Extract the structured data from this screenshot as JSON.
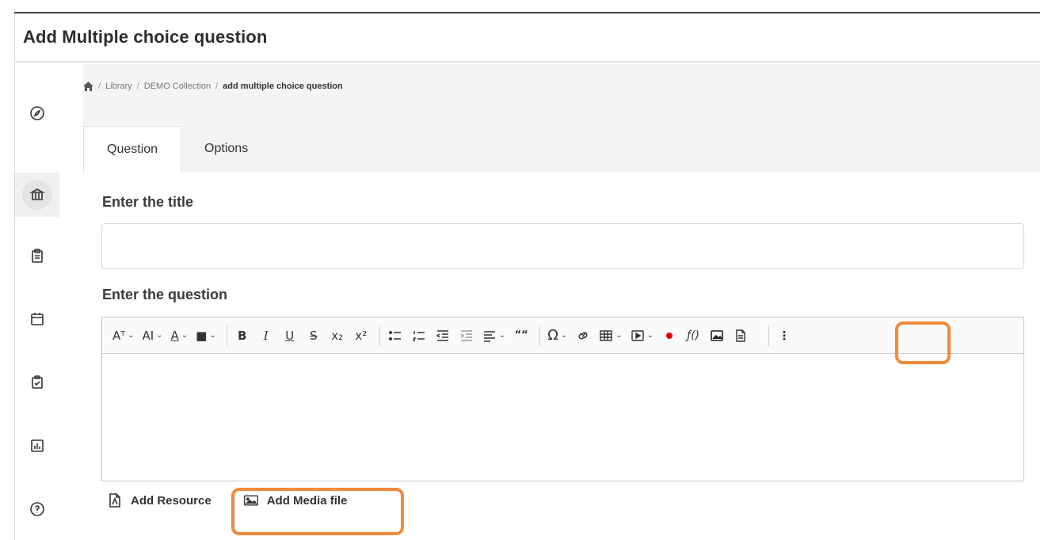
{
  "header": {
    "title": "Add Multiple choice question"
  },
  "breadcrumb": {
    "home_icon": "home-icon",
    "items": [
      "Library",
      "DEMO Collection"
    ],
    "current": "add multiple choice question",
    "separator": "/"
  },
  "sidebar": {
    "items": [
      "compass-icon",
      "library-icon",
      "clipboard-icon",
      "calendar-icon",
      "checklist-icon",
      "chart-icon",
      "help-icon"
    ]
  },
  "tabs": [
    {
      "label": "Question"
    },
    {
      "label": "Options"
    }
  ],
  "form": {
    "title_label": "Enter the title",
    "title_value": "",
    "question_label": "Enter the question"
  },
  "toolbar": {
    "buttons": [
      "Aᵀ",
      "AI",
      "A",
      "■",
      "B",
      "I",
      "U",
      "S",
      "x₂",
      "x²",
      "Ω",
      "““"
    ]
  },
  "actions": {
    "add_resource": "Add Resource",
    "add_media": "Add Media file"
  },
  "colors": {
    "highlight": "#f08a3c",
    "record": "#e00000"
  }
}
